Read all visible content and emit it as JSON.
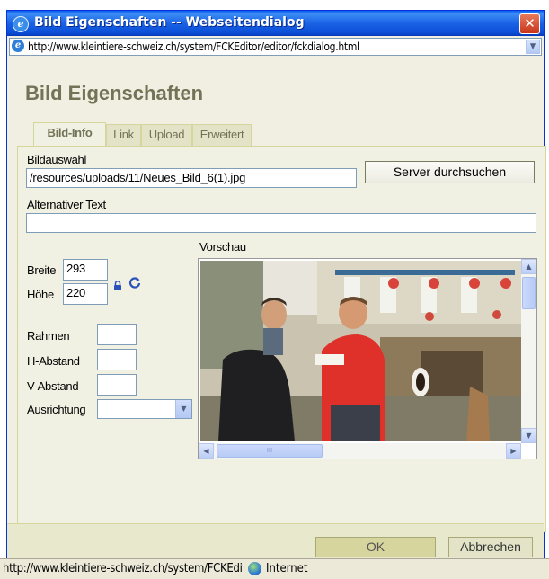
{
  "window": {
    "title": "Bild Eigenschaften -- Webseitendialog",
    "close": "✕",
    "address": "http://www.kleintiere-schweiz.ch/system/FCKEditor/editor/fckdialog.html"
  },
  "dialog": {
    "title": "Bild Eigenschaften",
    "tabs": [
      "Bild-Info",
      "Link",
      "Upload",
      "Erweitert"
    ],
    "active_tab": "Bild-Info"
  },
  "form": {
    "bildauswahl_label": "Bildauswahl",
    "bildauswahl_value": "/resources/uploads/11/Neues_Bild_6(1).jpg",
    "server_button": "Server durchsuchen",
    "alt_label": "Alternativer Text",
    "alt_value": "",
    "breite_label": "Breite",
    "breite_value": "293",
    "hoehe_label": "Höhe",
    "hoehe_value": "220",
    "rahmen_label": "Rahmen",
    "rahmen_value": "",
    "habstand_label": "H-Abstand",
    "habstand_value": "",
    "vabstand_label": "V-Abstand",
    "vabstand_value": "",
    "ausrichtung_label": "Ausrichtung",
    "ausrichtung_value": "",
    "vorschau_label": "Vorschau"
  },
  "buttons": {
    "ok": "OK",
    "cancel": "Abbrechen"
  },
  "statusbar": {
    "url": "http://www.kleintiere-schweiz.ch/system/FCKEditor/editor/fckdialog.html",
    "zone": "Internet"
  },
  "icons": {
    "lock": "lock-icon",
    "reset": "reset-size-icon",
    "scroll_up": "▲",
    "scroll_down": "▼",
    "scroll_left": "◀",
    "scroll_right": "▶",
    "dropdown": "▼",
    "grip": "III"
  },
  "colors": {
    "title_bar": "#1a62e6",
    "dialog_bg": "#f1f1e3",
    "heading": "#737357",
    "button_bar": "#e8e8cd"
  }
}
